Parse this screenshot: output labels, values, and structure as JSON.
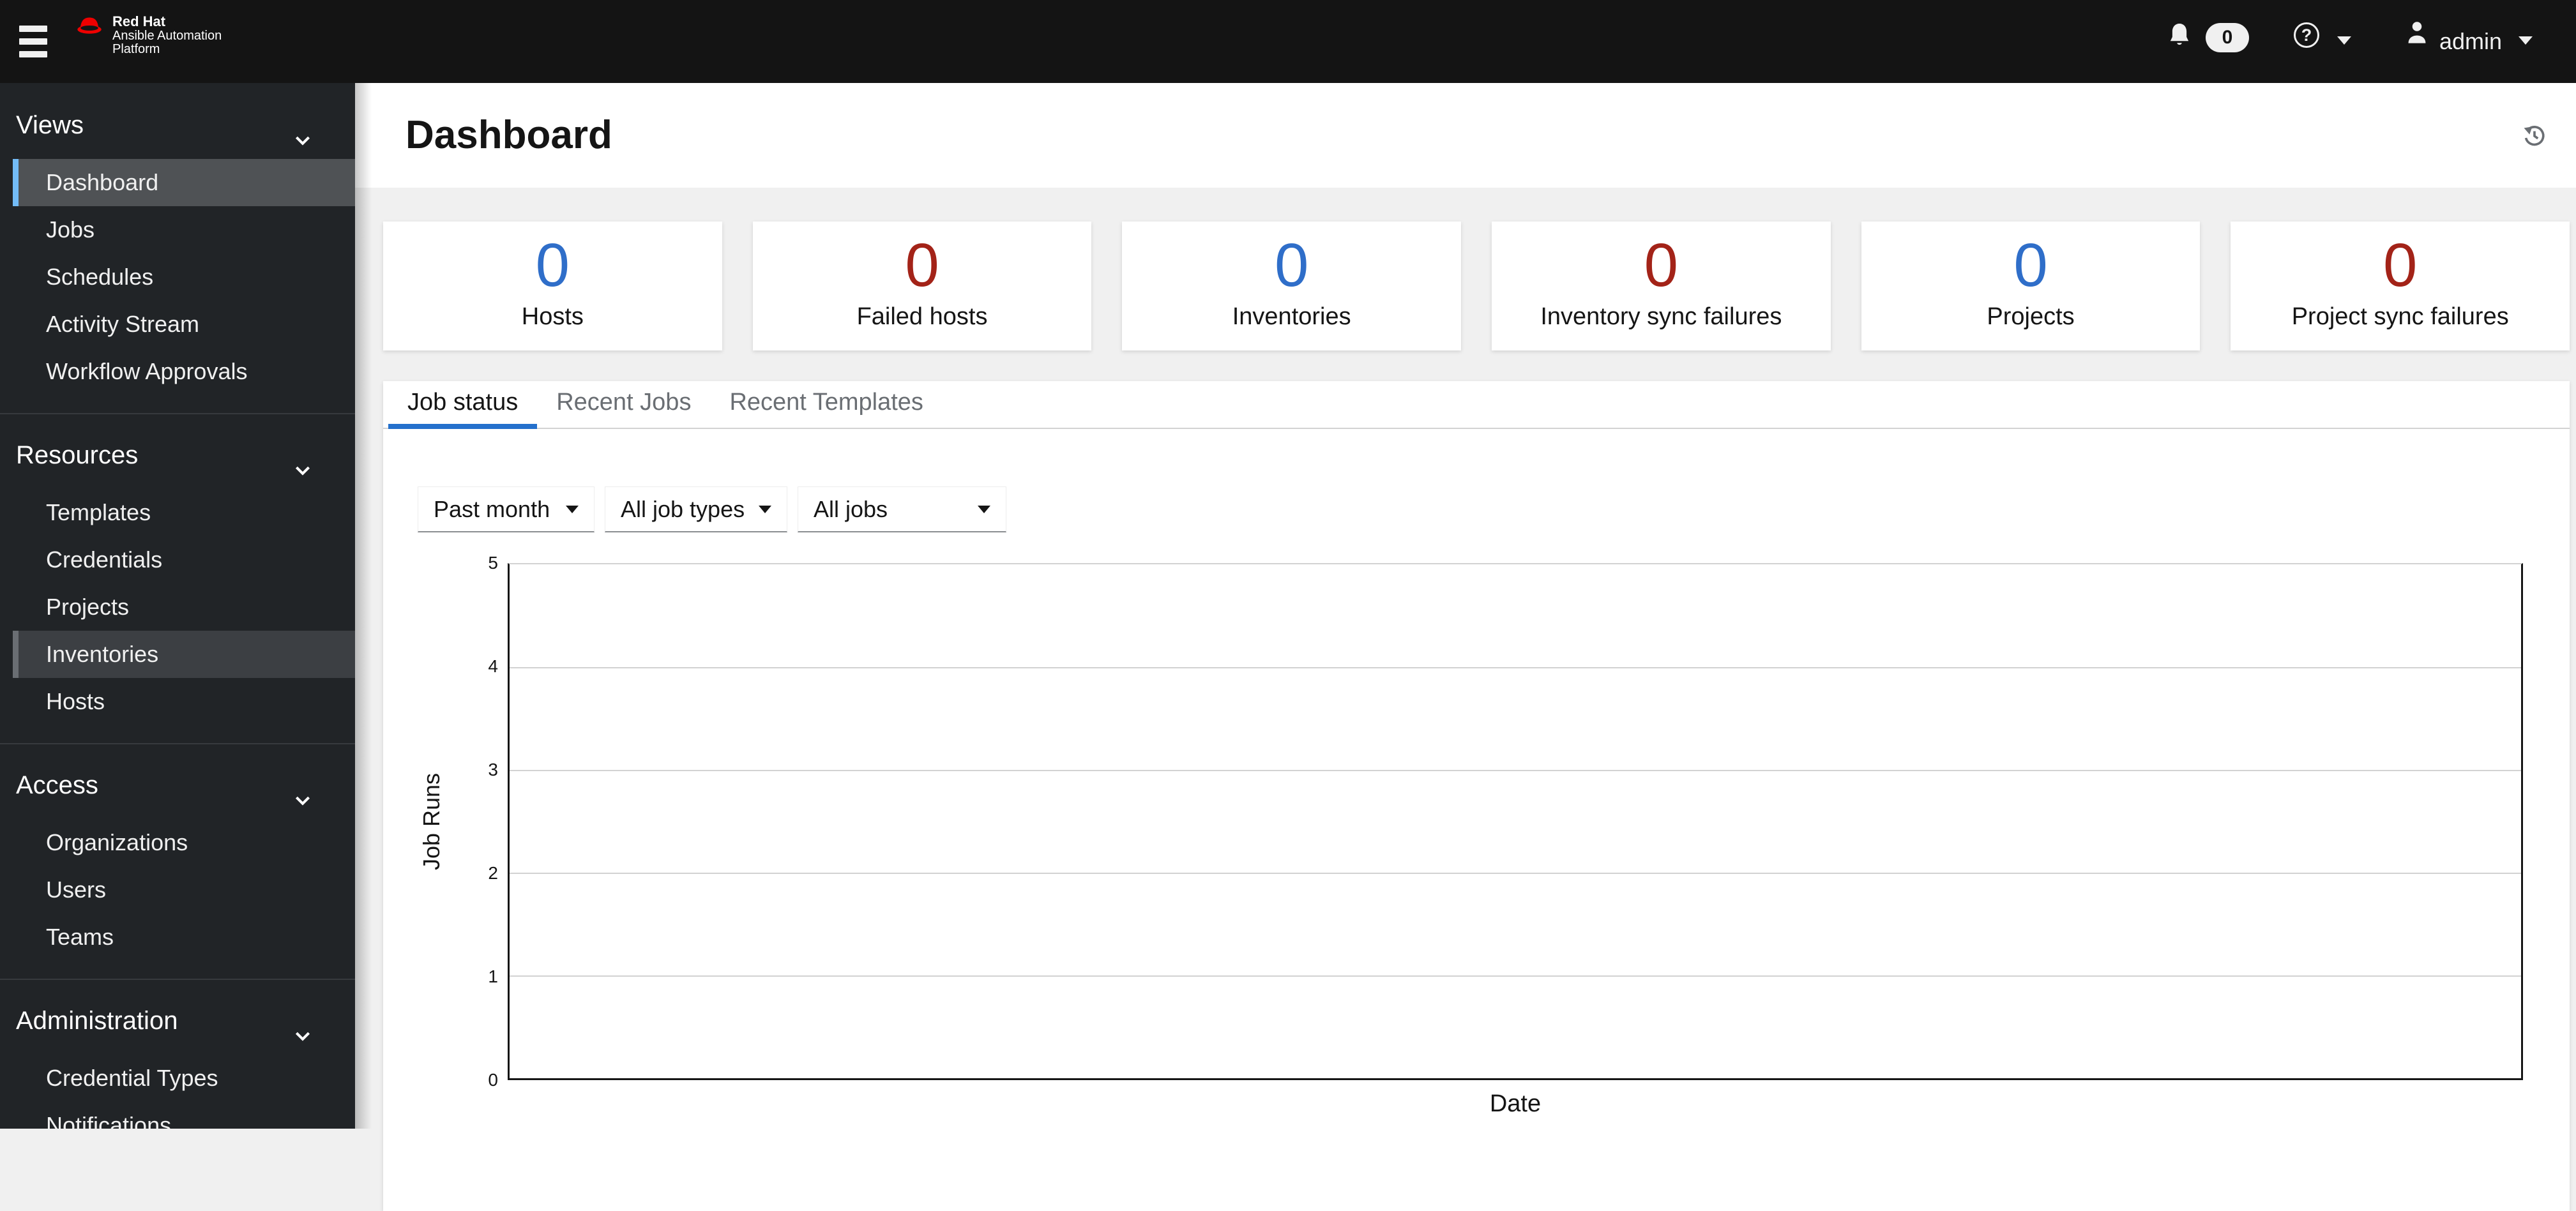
{
  "masthead": {
    "brand": {
      "line1": "Red Hat",
      "line2": "Ansible Automation",
      "line3": "Platform"
    },
    "notifications": {
      "count": "0"
    },
    "help_glyph": "?",
    "user": {
      "name": "admin"
    }
  },
  "sidebar": {
    "sections": [
      {
        "label": "Views",
        "items": [
          "Dashboard",
          "Jobs",
          "Schedules",
          "Activity Stream",
          "Workflow Approvals"
        ]
      },
      {
        "label": "Resources",
        "items": [
          "Templates",
          "Credentials",
          "Projects",
          "Inventories",
          "Hosts"
        ]
      },
      {
        "label": "Access",
        "items": [
          "Organizations",
          "Users",
          "Teams"
        ]
      },
      {
        "label": "Administration",
        "items": [
          "Credential Types",
          "Notifications"
        ]
      }
    ],
    "active_item": "Dashboard",
    "hovered_item": "Inventories"
  },
  "page": {
    "title": "Dashboard"
  },
  "stats": [
    {
      "label": "Hosts",
      "value": "0",
      "color": "#2f6ec9"
    },
    {
      "label": "Failed hosts",
      "value": "0",
      "color": "#a32318"
    },
    {
      "label": "Inventories",
      "value": "0",
      "color": "#2f6ec9"
    },
    {
      "label": "Inventory sync failures",
      "value": "0",
      "color": "#a32318"
    },
    {
      "label": "Projects",
      "value": "0",
      "color": "#2f6ec9"
    },
    {
      "label": "Project sync failures",
      "value": "0",
      "color": "#a32318"
    }
  ],
  "tabs": [
    {
      "label": "Job status",
      "active": true
    },
    {
      "label": "Recent Jobs",
      "active": false
    },
    {
      "label": "Recent Templates",
      "active": false
    }
  ],
  "filters": [
    {
      "name": "period",
      "value": "Past month"
    },
    {
      "name": "job-type",
      "value": "All job types"
    },
    {
      "name": "job",
      "value": "All jobs"
    }
  ],
  "chart_data": {
    "type": "line",
    "x": [],
    "series": [],
    "empty": true,
    "xlabel": "Date",
    "ylabel": "Job Runs",
    "ylim": [
      0,
      5
    ],
    "yticks": [
      0,
      1,
      2,
      3,
      4,
      5
    ],
    "yticks_desc": [
      "5",
      "4",
      "3",
      "2",
      "1",
      "0"
    ],
    "grid": true,
    "legend": false
  },
  "colors": {
    "masthead_bg": "#141414",
    "sidebar_bg": "#212427",
    "active_nav_bg": "#4f5255",
    "active_nav_border": "#73bcf7",
    "hover_nav_bg": "#3c3f43",
    "page_bg": "#f0f0f0",
    "stat_blue": "#2f6ec9",
    "stat_red": "#a32318",
    "tab_active_underline": "#2470cc",
    "muted_text": "#6a6e73",
    "gridline": "#d2d2d2"
  }
}
